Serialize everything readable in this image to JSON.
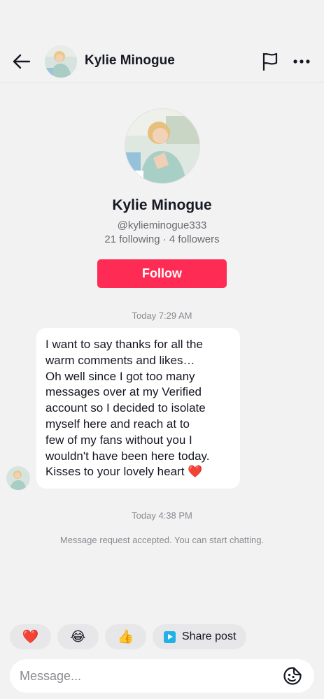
{
  "header": {
    "contact_name": "Kylie Minogue",
    "icons": [
      "back-arrow-icon",
      "flag-icon",
      "more-icon"
    ]
  },
  "profile": {
    "name": "Kylie Minogue",
    "handle": "@kylieminogue333",
    "stats": "21 following · 4 followers",
    "follow_label": "Follow"
  },
  "conversation": {
    "timestamp_1": "Today 7:29 AM",
    "message_lines": [
      "I want to say thanks for all the",
      "warm comments and likes…",
      "Oh well since I got too many",
      "messages over at my Verified",
      "account so I decided to isolate",
      "myself here and reach at to",
      "few of my fans without you I",
      "wouldn't have been here today.",
      "Kisses to your lovely heart ❤️"
    ],
    "timestamp_2": "Today 4:38 PM",
    "system_note": "Message request accepted. You can start chatting."
  },
  "quick_replies": {
    "heart": "❤️",
    "laugh": "😂",
    "thumbs_up": "👍",
    "share_label": "Share post"
  },
  "composer": {
    "placeholder": "Message..."
  },
  "colors": {
    "accent": "#fe2c55",
    "background": "#f2f2f2",
    "bubble": "#ffffff",
    "muted_text": "#8a8b91"
  }
}
